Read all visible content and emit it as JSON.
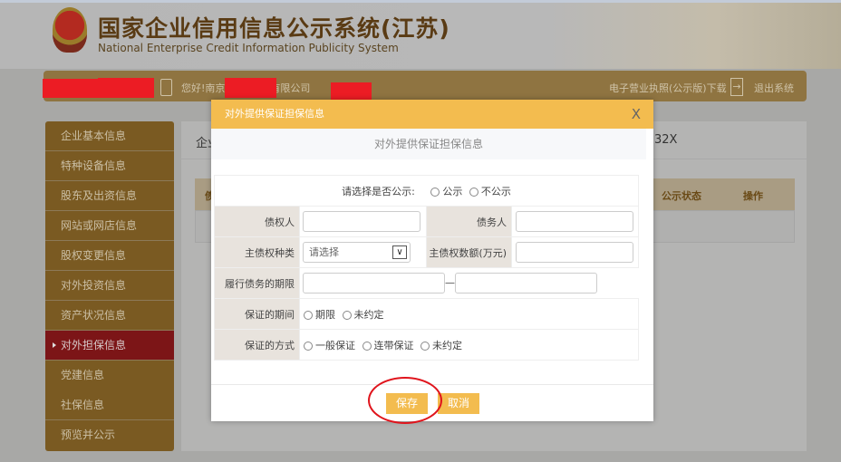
{
  "header": {
    "title": "国家企业信用信息公示系统(江苏)",
    "subtitle": "National Enterprise Credit Information Publicity System",
    "greeting": "您好!南京",
    "greeting_suffix": "有限公司",
    "download_link": "电子营业执照(公示版)下载",
    "logout": "退出系统"
  },
  "sidebar": {
    "items": [
      {
        "label": "企业基本信息"
      },
      {
        "label": "特种设备信息"
      },
      {
        "label": "股东及出资信息"
      },
      {
        "label": "网站或网店信息"
      },
      {
        "label": "股权变更信息"
      },
      {
        "label": "对外投资信息"
      },
      {
        "label": "资产状况信息"
      },
      {
        "label": "对外担保信息",
        "active": true
      },
      {
        "label": "党建信息"
      },
      {
        "label": "社保信息"
      },
      {
        "label": "预览并公示"
      }
    ]
  },
  "content": {
    "title_partial": "企业",
    "code_partial": "32X",
    "table_headers": [
      "债",
      "公示状态",
      "操作"
    ]
  },
  "modal": {
    "title": "对外提供保证担保信息",
    "subtitle": "对外提供保证担保信息",
    "close": "X",
    "publish_prompt": "请选择是否公示:",
    "publish_options": [
      "公示",
      "不公示"
    ],
    "creditor_label": "债权人",
    "creditor_value": "",
    "debtor_label": "债务人",
    "debtor_value": "",
    "claim_type_label": "主债权种类",
    "claim_type_value": "请选择",
    "claim_amount_label": "主债权数额(万元)",
    "claim_amount_value": "",
    "term_label": "履行债务的期限",
    "term_separator": "—",
    "term_start": "",
    "term_end": "",
    "period_label": "保证的期间",
    "period_options": [
      "期限",
      "未约定"
    ],
    "method_label": "保证的方式",
    "method_options": [
      "一般保证",
      "连带保证",
      "未约定"
    ],
    "save": "保存",
    "cancel": "取消"
  }
}
